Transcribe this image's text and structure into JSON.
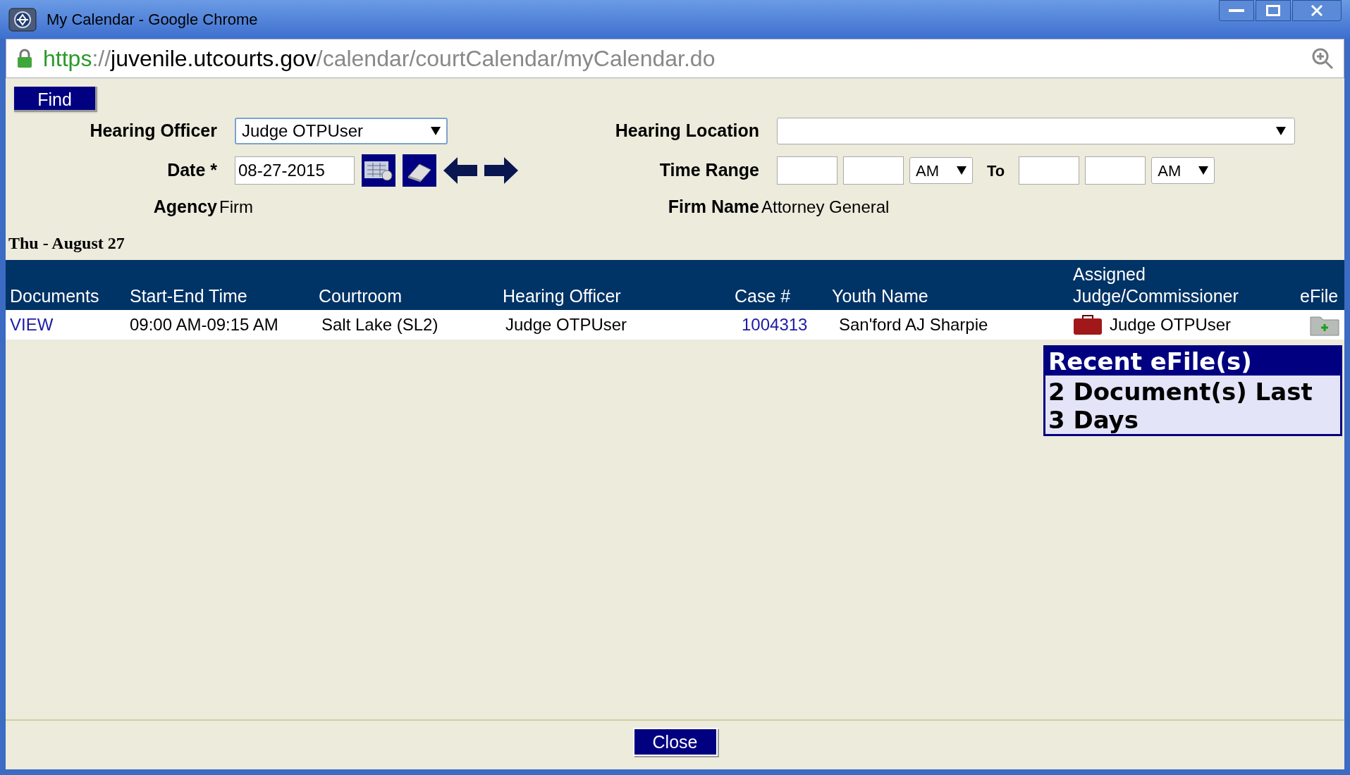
{
  "window": {
    "title": "My Calendar - Google Chrome"
  },
  "address_bar": {
    "scheme": "https",
    "separator": "://",
    "host": "juvenile.utcourts.gov",
    "path": "/calendar/courtCalendar/myCalendar.do"
  },
  "find_button": "Find",
  "filters": {
    "hearing_officer": {
      "label": "Hearing Officer",
      "value": "Judge OTPUser"
    },
    "hearing_location": {
      "label": "Hearing Location"
    },
    "date": {
      "label": "Date *",
      "value": "08-27-2015"
    },
    "time_range": {
      "label": "Time Range",
      "from_ampm": "AM",
      "to_label": "To",
      "to_ampm": "AM"
    },
    "agency": {
      "label": "Agency",
      "value": "Firm"
    },
    "firm_name": {
      "label": "Firm Name",
      "value": "Attorney General"
    }
  },
  "day_heading": "Thu - August 27",
  "table": {
    "columns": [
      "Documents",
      "Start-End Time",
      "Courtroom",
      "Hearing Officer",
      "Case #",
      "Youth Name",
      "Assigned Judge/Commissioner",
      "eFile"
    ],
    "rows": [
      {
        "documents": "VIEW",
        "time": "09:00 AM-09:15 AM",
        "courtroom": "Salt Lake (SL2)",
        "hearing_officer": "Judge OTPUser",
        "case": "1004313",
        "youth_name": "San'ford AJ Sharpie",
        "assigned_judge": "Judge OTPUser"
      }
    ]
  },
  "popup": {
    "title": "Recent eFile(s)",
    "body": "2 Document(s) Last 3 Days"
  },
  "close_button": "Close"
}
